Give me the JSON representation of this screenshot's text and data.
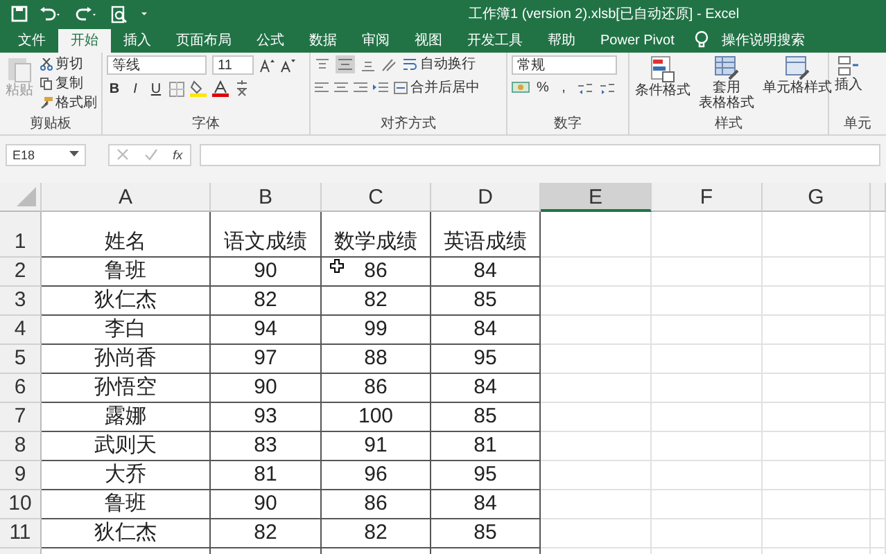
{
  "title_bar": {
    "title": "工作簿1 (version 2).xlsb[已自动还原]  -  Excel"
  },
  "tabs": [
    {
      "label": "文件",
      "selected": false
    },
    {
      "label": "开始",
      "selected": true
    },
    {
      "label": "插入",
      "selected": false
    },
    {
      "label": "页面布局",
      "selected": false
    },
    {
      "label": "公式",
      "selected": false
    },
    {
      "label": "数据",
      "selected": false
    },
    {
      "label": "审阅",
      "selected": false
    },
    {
      "label": "视图",
      "selected": false
    },
    {
      "label": "开发工具",
      "selected": false
    },
    {
      "label": "帮助",
      "selected": false
    },
    {
      "label": "Power Pivot",
      "selected": false
    }
  ],
  "tell_me": {
    "label": "操作说明搜索"
  },
  "ribbon": {
    "clipboard": {
      "label": "剪贴板",
      "paste": {
        "label": "粘贴",
        "disabled": true
      },
      "cut": "剪切",
      "copy": "复制",
      "format_painter": "格式刷"
    },
    "font": {
      "label": "字体",
      "font_name": "等线",
      "font_size": "11",
      "bold": "B",
      "italic": "I",
      "underline": "U"
    },
    "alignment": {
      "label": "对齐方式",
      "wrap_text": "自动换行",
      "merge_center": "合并后居中"
    },
    "number": {
      "label": "数字",
      "format": "常规",
      "percent": "%",
      "comma": ","
    },
    "styles": {
      "label": "样式",
      "conditional": "条件格式",
      "table_lines": [
        "套用",
        "表格格式"
      ],
      "cell_styles": "单元格样式"
    },
    "cells": {
      "label": "单元",
      "insert": "插入"
    }
  },
  "formula_bar": {
    "name_box": "E18",
    "fx": "fx"
  },
  "sheet": {
    "columns": [
      {
        "label": "A",
        "selected": false
      },
      {
        "label": "B",
        "selected": false
      },
      {
        "label": "C",
        "selected": false
      },
      {
        "label": "D",
        "selected": false
      },
      {
        "label": "E",
        "selected": true
      },
      {
        "label": "F",
        "selected": false
      },
      {
        "label": "G",
        "selected": false
      }
    ],
    "rows": [
      {
        "header": "1",
        "cells": [
          "姓名",
          "语文成绩",
          "数学成绩",
          "英语成绩"
        ]
      },
      {
        "header": "2",
        "cells": [
          "鲁班",
          "90",
          "86",
          "84"
        ]
      },
      {
        "header": "3",
        "cells": [
          "狄仁杰",
          "82",
          "82",
          "85"
        ]
      },
      {
        "header": "4",
        "cells": [
          "李白",
          "94",
          "99",
          "84"
        ]
      },
      {
        "header": "5",
        "cells": [
          "孙尚香",
          "97",
          "88",
          "95"
        ]
      },
      {
        "header": "6",
        "cells": [
          "孙悟空",
          "90",
          "86",
          "84"
        ]
      },
      {
        "header": "7",
        "cells": [
          "露娜",
          "93",
          "100",
          "85"
        ]
      },
      {
        "header": "8",
        "cells": [
          "武则天",
          "83",
          "91",
          "81"
        ]
      },
      {
        "header": "9",
        "cells": [
          "大乔",
          "81",
          "96",
          "95"
        ]
      },
      {
        "header": "10",
        "cells": [
          "鲁班",
          "90",
          "86",
          "84"
        ]
      },
      {
        "header": "11",
        "cells": [
          "狄仁杰",
          "82",
          "82",
          "85"
        ]
      }
    ]
  }
}
